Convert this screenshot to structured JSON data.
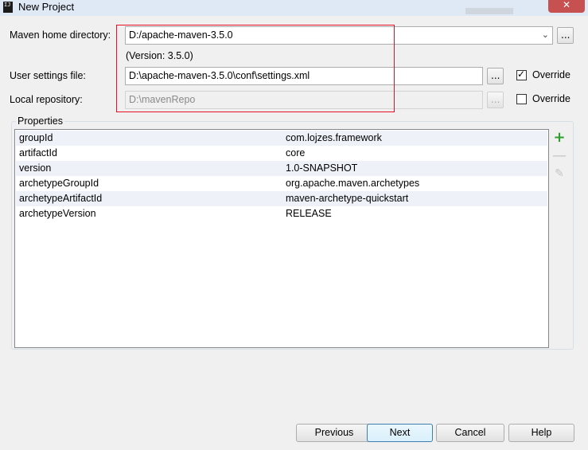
{
  "window": {
    "title": "New Project",
    "close_glyph": "✕"
  },
  "maven_home": {
    "label": "Maven home directory:",
    "value": "D:/apache-maven-3.5.0",
    "version_text": "(Version: 3.5.0)",
    "browse": "..."
  },
  "user_settings": {
    "label": "User settings file:",
    "value": "D:\\apache-maven-3.5.0\\conf\\settings.xml",
    "browse": "...",
    "override_label": "Override",
    "override_checked": true
  },
  "local_repo": {
    "label": "Local repository:",
    "value": "D:\\mavenRepo",
    "browse": "...",
    "override_label": "Override",
    "override_checked": false
  },
  "properties": {
    "title": "Properties",
    "rows": [
      {
        "key": "groupId",
        "value": "com.lojzes.framework"
      },
      {
        "key": "artifactId",
        "value": "core"
      },
      {
        "key": "version",
        "value": "1.0-SNAPSHOT"
      },
      {
        "key": "archetypeGroupId",
        "value": "org.apache.maven.archetypes"
      },
      {
        "key": "archetypeArtifactId",
        "value": "maven-archetype-quickstart"
      },
      {
        "key": "archetypeVersion",
        "value": "RELEASE"
      }
    ],
    "tools": {
      "add": "+",
      "remove": "—",
      "edit": "✎"
    }
  },
  "buttons": {
    "previous": "Previous",
    "next": "Next",
    "cancel": "Cancel",
    "help": "Help"
  },
  "colors": {
    "highlight_box": "#e81123",
    "add_icon": "#2e9d2e"
  }
}
